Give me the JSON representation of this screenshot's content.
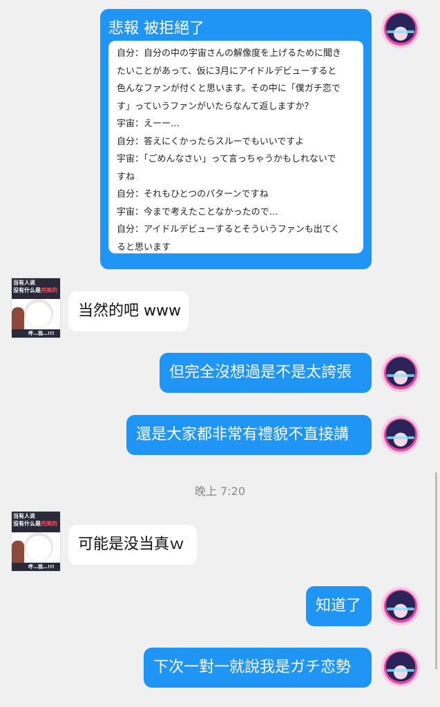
{
  "messages": {
    "post": {
      "title": "悲報 被拒絕了",
      "body": "自分：自分の中の宇宙さんの解像度を上げるために聞き\nたいことがあって、仮に3月にアイドルデビューすると\n色んなファンが付くと思います。その中に「僕ガチ恋で\nす」っていうファンがいたらなんて返しますか？\n宇宙：えーー…\n自分：答えにくかったらスルーでもいいですよ\n宇宙：「ごめんなさい」って言っちゃうかもしれないで\nすね\n自分：それもひとつのパターンですね\n宇宙：今まで考えたことなかったので…\n自分：アイドルデビューするとそういうファンも出てく\nると思います"
    },
    "msg1": "当然的吧 www",
    "msg2": "但完全沒想過是不是太誇張",
    "msg3": "還是大家都非常有禮貌不直接講",
    "timestamp": "晚上 7:20",
    "msg4": "可能是没当真ｗ",
    "msg5": "知道了",
    "msg6": "下次一對一就說我是ガチ恋勢"
  },
  "avatar_other": {
    "line1": "当有人说",
    "line2": "没有什么是",
    "highlight": "完美的",
    "bottom": "呼…我…!!!"
  },
  "colors": {
    "bubble_me": "#1f96f6",
    "bubble_other": "#ffffff",
    "background": "#f0f0f0"
  },
  "icons": {
    "avatar_me": "avatar-anime-girl-icon",
    "avatar_other": "avatar-sticker-icon"
  }
}
